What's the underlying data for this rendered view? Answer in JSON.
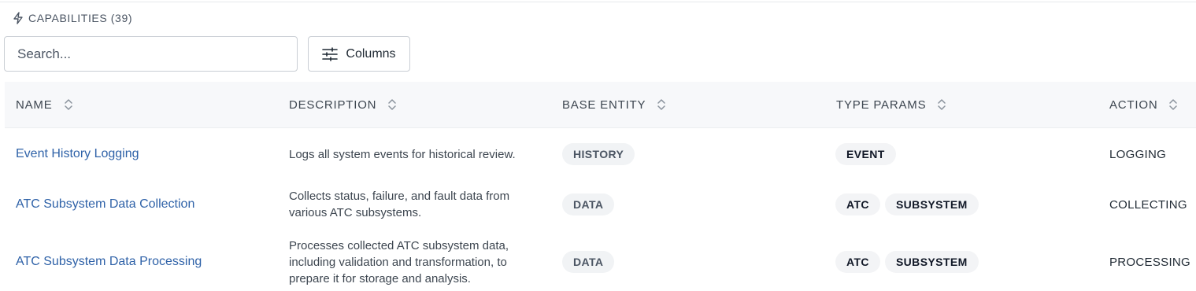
{
  "section": {
    "title": "CAPABILITIES (39)",
    "icon": "lightning-icon"
  },
  "search": {
    "placeholder": "Search..."
  },
  "toolbar": {
    "columns_label": "Columns",
    "columns_icon": "sliders-icon"
  },
  "table": {
    "headers": {
      "name": "NAME",
      "description": "DESCRIPTION",
      "base_entity": "BASE ENTITY",
      "type_params": "TYPE PARAMS",
      "action": "ACTION"
    },
    "rows": [
      {
        "name": "Event History Logging",
        "description": "Logs all system events for historical review.",
        "base_entity": "HISTORY",
        "type_params": [
          "EVENT"
        ],
        "action": "LOGGING"
      },
      {
        "name": "ATC Subsystem Data Collection",
        "description": "Collects status, failure, and fault data from various ATC subsystems.",
        "base_entity": "DATA",
        "type_params": [
          "ATC",
          "SUBSYSTEM"
        ],
        "action": "COLLECTING"
      },
      {
        "name": "ATC Subsystem Data Processing",
        "description": "Processes collected ATC subsystem data, including validation and transformation, to prepare it for storage and analysis.",
        "base_entity": "DATA",
        "type_params": [
          "ATC",
          "SUBSYSTEM"
        ],
        "action": "PROCESSING"
      }
    ]
  },
  "colors": {
    "link": "#2f62a8",
    "header_bg": "#f7f8fa",
    "pill_bg": "#f1f3f5"
  }
}
